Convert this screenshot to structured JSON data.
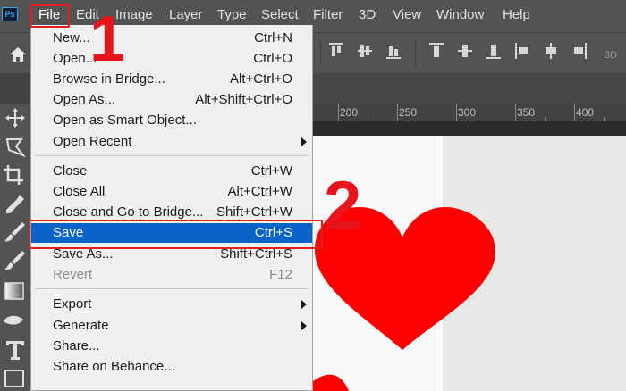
{
  "app": {
    "logo_text": "Ps"
  },
  "menubar": {
    "items": [
      "File",
      "Edit",
      "Image",
      "Layer",
      "Type",
      "Select",
      "Filter",
      "3D",
      "View",
      "Window",
      "Help"
    ]
  },
  "optionsbar": {
    "threed_label": "3D"
  },
  "ruler": {
    "labels": [
      "200",
      "250",
      "300",
      "350",
      "400"
    ]
  },
  "file_menu": {
    "items": [
      {
        "label": "New...",
        "shortcut": "Ctrl+N"
      },
      {
        "label": "Open...",
        "shortcut": "Ctrl+O"
      },
      {
        "label": "Browse in Bridge...",
        "shortcut": "Alt+Ctrl+O"
      },
      {
        "label": "Open As...",
        "shortcut": "Alt+Shift+Ctrl+O"
      },
      {
        "label": "Open as Smart Object...",
        "shortcut": ""
      },
      {
        "label": "Open Recent",
        "shortcut": "",
        "submenu": true
      },
      {
        "label": "Close",
        "shortcut": "Ctrl+W"
      },
      {
        "label": "Close All",
        "shortcut": "Alt+Ctrl+W"
      },
      {
        "label": "Close and Go to Bridge...",
        "shortcut": "Shift+Ctrl+W"
      },
      {
        "label": "Save",
        "shortcut": "Ctrl+S",
        "selected": true
      },
      {
        "label": "Save As...",
        "shortcut": "Shift+Ctrl+S"
      },
      {
        "label": "Revert",
        "shortcut": "F12",
        "disabled": true
      },
      {
        "label": "Export",
        "shortcut": "",
        "submenu": true
      },
      {
        "label": "Generate",
        "shortcut": "",
        "submenu": true
      },
      {
        "label": "Share...",
        "shortcut": ""
      },
      {
        "label": "Share on Behance...",
        "shortcut": ""
      }
    ]
  },
  "annotations": {
    "step1": "1",
    "step2": "2"
  },
  "colors": {
    "selected": "#0a64c8",
    "annotation": "#e8141c",
    "heart": "#ff0000",
    "menubar": "#535353"
  }
}
